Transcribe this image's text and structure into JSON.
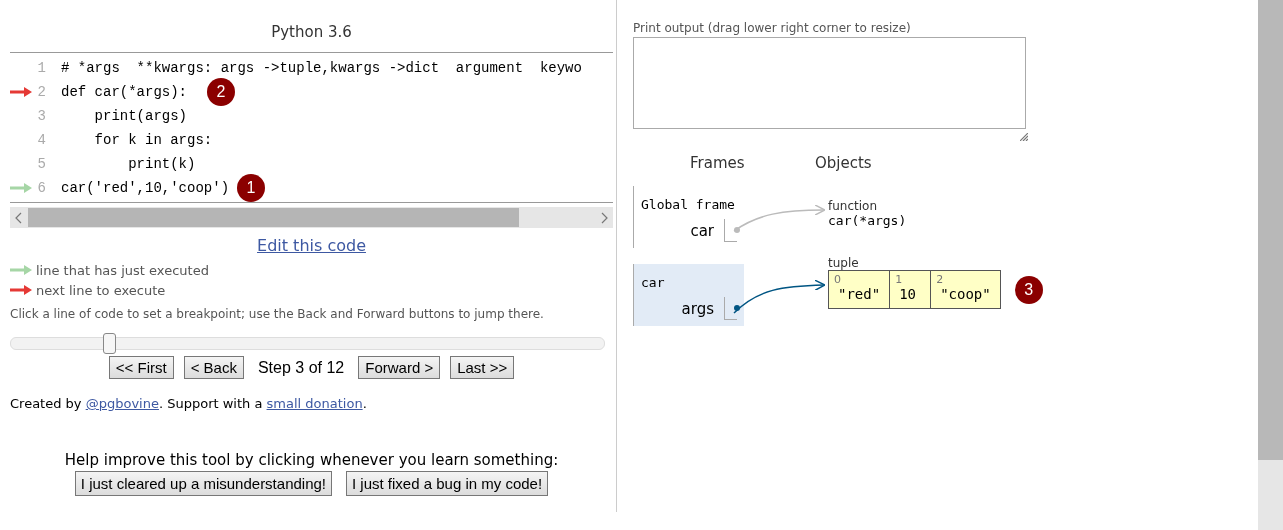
{
  "title": "Python 3.6",
  "code_lines": [
    {
      "number": "1",
      "text": "# *args  **kwargs: args ->tuple,kwargs ->dict  argument  keywo",
      "kind": "plain"
    },
    {
      "number": "2",
      "text": "def car(*args):",
      "kind": "next",
      "badge": "2"
    },
    {
      "number": "3",
      "text": "    print(args)",
      "kind": "plain"
    },
    {
      "number": "4",
      "text": "    for k in args:",
      "kind": "plain"
    },
    {
      "number": "5",
      "text": "        print(k)",
      "kind": "plain"
    },
    {
      "number": "6",
      "text": "car('red',10,'coop')",
      "kind": "executed",
      "badge": "1"
    }
  ],
  "edit_link": "Edit this code",
  "legend": [
    {
      "kind": "executed",
      "text": "line that has just executed"
    },
    {
      "kind": "next",
      "text": "next line to execute"
    }
  ],
  "hint": "Click a line of code to set a breakpoint; use the Back and Forward buttons to jump there.",
  "slider": {
    "level": 0.167
  },
  "nav": [
    {
      "kind": "button",
      "label": "<< First"
    },
    {
      "kind": "button",
      "label": "< Back"
    },
    {
      "kind": "status",
      "label": "Step 3 of 12"
    },
    {
      "kind": "button",
      "label": "Forward >"
    },
    {
      "kind": "button",
      "label": "Last >>"
    }
  ],
  "credit": [
    {
      "kind": "text",
      "text": "Created by "
    },
    {
      "kind": "link",
      "text": "@pgbovine"
    },
    {
      "kind": "text",
      "text": ". Support with a "
    },
    {
      "kind": "link",
      "text": "small donation"
    },
    {
      "kind": "text",
      "text": "."
    }
  ],
  "feedback": {
    "prompt": "Help improve this tool by clicking whenever you learn something:",
    "buttons": [
      "I just cleared up a misunderstanding!",
      "I just fixed a bug in my code!"
    ]
  },
  "output": {
    "label": "Print output (drag lower right corner to resize)"
  },
  "visualization": {
    "frames_header": "Frames",
    "objects_header": "Objects",
    "frames": [
      {
        "name": "Global frame",
        "highlighted": false,
        "vars": [
          {
            "name": "car"
          }
        ]
      },
      {
        "name": "car",
        "highlighted": true,
        "vars": [
          {
            "name": "args"
          }
        ]
      }
    ],
    "objects": [
      {
        "kind": "function",
        "label": "function",
        "text": "car(*args)"
      },
      {
        "kind": "tuple",
        "label": "tuple",
        "badge": "3",
        "items": [
          {
            "index": "0",
            "value": "\"red\""
          },
          {
            "index": "1",
            "value": "10"
          },
          {
            "index": "2",
            "value": "\"coop\""
          }
        ]
      }
    ]
  }
}
